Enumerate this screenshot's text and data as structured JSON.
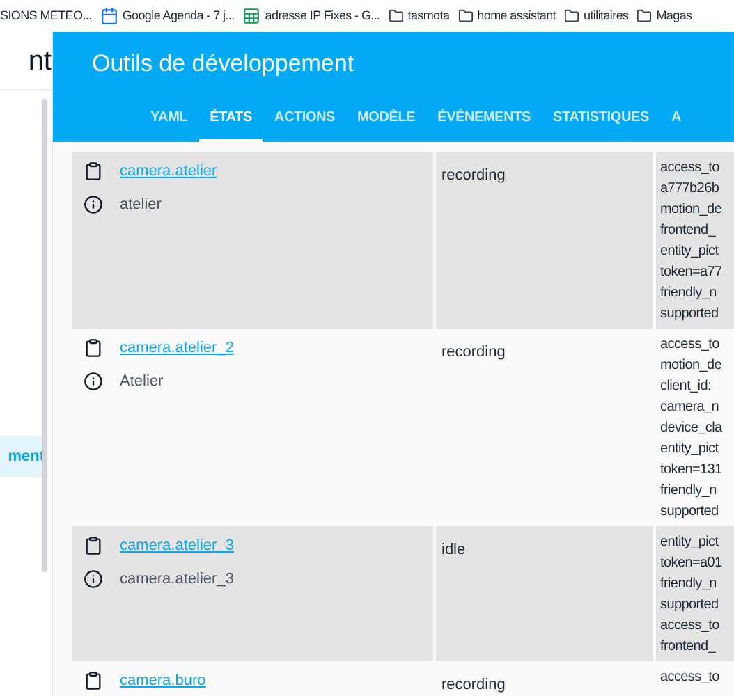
{
  "bookmarks": [
    {
      "kind": "plain",
      "label": "SIONS METEO..."
    },
    {
      "kind": "calendar",
      "label": "Google Agenda - 7 j..."
    },
    {
      "kind": "sheet",
      "label": "adresse IP Fixes - G..."
    },
    {
      "kind": "folder",
      "label": "tasmota"
    },
    {
      "kind": "folder",
      "label": "home assistant"
    },
    {
      "kind": "folder",
      "label": "utilitaires"
    },
    {
      "kind": "folder",
      "label": "Magas"
    }
  ],
  "sidebar": {
    "title": "nt",
    "items": [
      {
        "label": "ment",
        "selected": true
      }
    ]
  },
  "header": {
    "title": "Outils de développement"
  },
  "tabs": [
    {
      "label": "YAML",
      "selected": false
    },
    {
      "label": "ÉTATS",
      "selected": true
    },
    {
      "label": "ACTIONS",
      "selected": false
    },
    {
      "label": "MODÈLE",
      "selected": false
    },
    {
      "label": "ÉVÉNEMENTS",
      "selected": false
    },
    {
      "label": "STATISTIQUES",
      "selected": false
    },
    {
      "label": "A",
      "selected": false
    }
  ],
  "rows": [
    {
      "entity": "camera.atelier",
      "name": "atelier",
      "state": "recording",
      "attributes": [
        "access_to",
        "a777b26b",
        "motion_de",
        "frontend_",
        "entity_pict",
        "token=a77",
        "friendly_n",
        "supported"
      ]
    },
    {
      "entity": "camera.atelier_2",
      "name": "Atelier",
      "state": "recording",
      "attributes": [
        "access_to",
        "motion_de",
        "client_id:",
        "camera_n",
        "device_cla",
        "entity_pict",
        "token=131",
        "friendly_n",
        "supported"
      ]
    },
    {
      "entity": "camera.atelier_3",
      "name": "camera.atelier_3",
      "state": "idle",
      "attributes": [
        "entity_pict",
        "token=a01",
        "friendly_n",
        "supported",
        "access_to",
        "frontend_"
      ]
    },
    {
      "entity": "camera.buro",
      "state": "recording",
      "attributes": [
        "access_to"
      ]
    }
  ]
}
